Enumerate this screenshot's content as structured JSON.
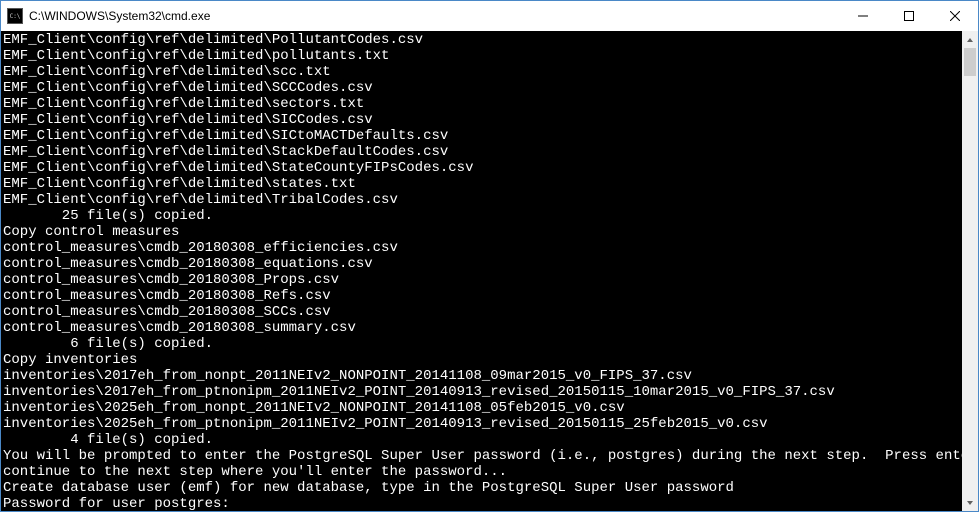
{
  "window": {
    "title": "C:\\WINDOWS\\System32\\cmd.exe"
  },
  "console": {
    "lines": [
      "EMF_Client\\config\\ref\\delimited\\PollutantCodes.csv",
      "EMF_Client\\config\\ref\\delimited\\pollutants.txt",
      "EMF_Client\\config\\ref\\delimited\\scc.txt",
      "EMF_Client\\config\\ref\\delimited\\SCCCodes.csv",
      "EMF_Client\\config\\ref\\delimited\\sectors.txt",
      "EMF_Client\\config\\ref\\delimited\\SICCodes.csv",
      "EMF_Client\\config\\ref\\delimited\\SICtoMACTDefaults.csv",
      "EMF_Client\\config\\ref\\delimited\\StackDefaultCodes.csv",
      "EMF_Client\\config\\ref\\delimited\\StateCountyFIPsCodes.csv",
      "EMF_Client\\config\\ref\\delimited\\states.txt",
      "EMF_Client\\config\\ref\\delimited\\TribalCodes.csv",
      "       25 file(s) copied.",
      "Copy control measures",
      "control_measures\\cmdb_20180308_efficiencies.csv",
      "control_measures\\cmdb_20180308_equations.csv",
      "control_measures\\cmdb_20180308_Props.csv",
      "control_measures\\cmdb_20180308_Refs.csv",
      "control_measures\\cmdb_20180308_SCCs.csv",
      "control_measures\\cmdb_20180308_summary.csv",
      "        6 file(s) copied.",
      "Copy inventories",
      "inventories\\2017eh_from_nonpt_2011NEIv2_NONPOINT_20141108_09mar2015_v0_FIPS_37.csv",
      "inventories\\2017eh_from_ptnonipm_2011NEIv2_POINT_20140913_revised_20150115_10mar2015_v0_FIPS_37.csv",
      "inventories\\2025eh_from_nonpt_2011NEIv2_NONPOINT_20141108_05feb2015_v0.csv",
      "inventories\\2025eh_from_ptnonipm_2011NEIv2_POINT_20140913_revised_20150115_25feb2015_v0.csv",
      "        4 file(s) copied.",
      "You will be prompted to enter the PostgreSQL Super User password (i.e., postgres) during the next step.  Press enter to",
      "continue to the next step where you'll enter the password...",
      "Create database user (emf) for new database, type in the PostgreSQL Super User password",
      "Password for user postgres:"
    ]
  }
}
